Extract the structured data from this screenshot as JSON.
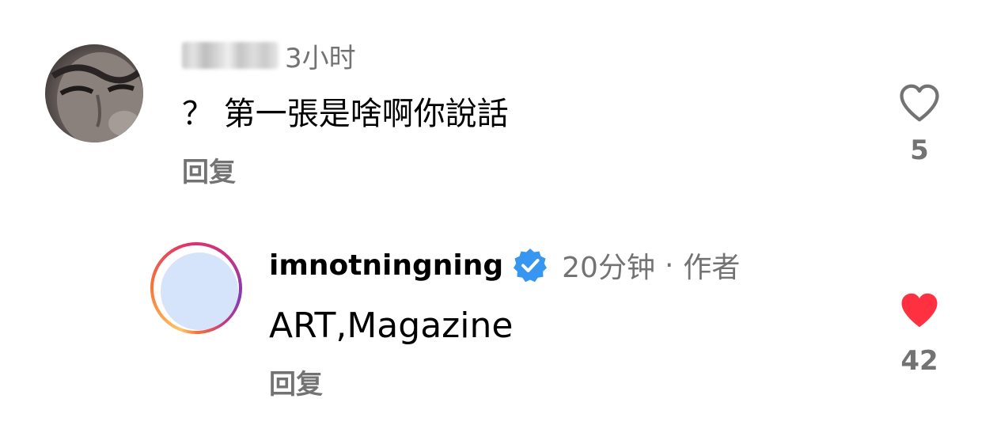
{
  "comments": [
    {
      "username_blurred": true,
      "timestamp": "3小时",
      "text": "？ 第一張是啥啊你說話",
      "reply_label": "回复",
      "like_icon": "heart-outline-icon",
      "like_count": "5",
      "liked": false
    },
    {
      "username": "imnotningning",
      "verified": true,
      "timestamp": "20分钟",
      "separator": "·",
      "author_badge": "作者",
      "text": "ART,Magazine",
      "reply_label": "回复",
      "like_icon": "heart-filled-icon",
      "like_count": "42",
      "liked": true
    }
  ],
  "colors": {
    "secondary_text": "#737373",
    "like_active": "#ff3040",
    "verified_blue": "#3797f0",
    "avatar_placeholder": "#d6e4fb"
  }
}
